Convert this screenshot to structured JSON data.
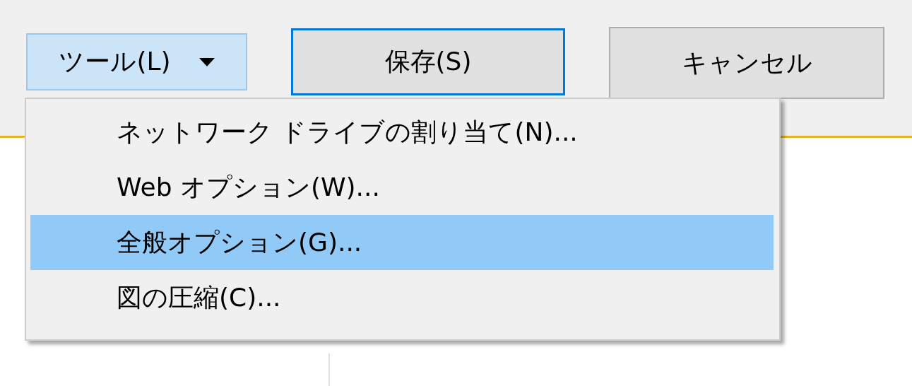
{
  "buttons": [
    {
      "kind": "dropdown",
      "label": "ツール(L)",
      "open": true
    },
    {
      "kind": "default",
      "label": "保存(S)"
    },
    {
      "kind": "normal",
      "label": "キャンセル"
    }
  ],
  "menu": {
    "items": [
      {
        "label": "ネットワーク ドライブの割り当て(N)...",
        "selected": false
      },
      {
        "label": "Web オプション(W)...",
        "selected": false
      },
      {
        "label": "全般オプション(G)...",
        "selected": true
      },
      {
        "label": "図の圧縮(C)...",
        "selected": false
      }
    ]
  }
}
